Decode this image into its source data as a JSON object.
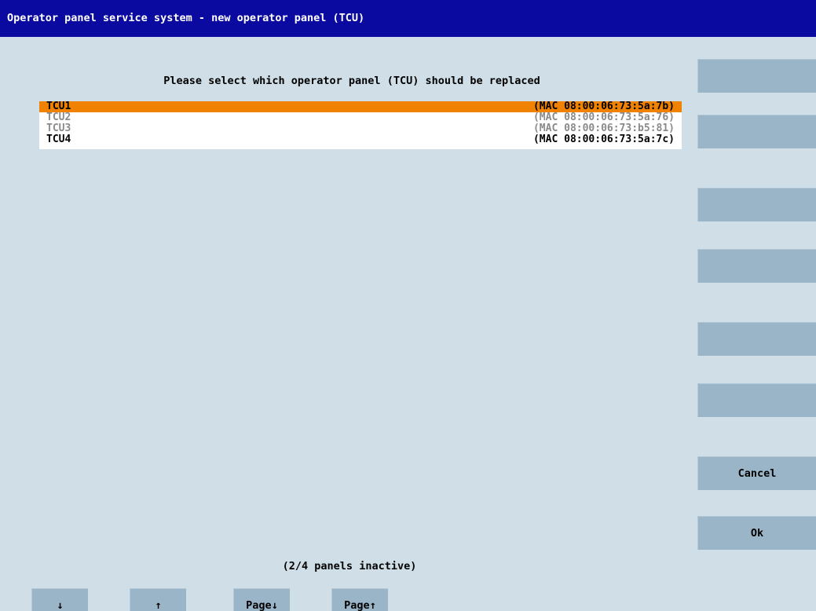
{
  "window": {
    "title": "Operator panel service system - new operator panel (TCU)"
  },
  "prompt": "Please select which operator panel (TCU) should be replaced",
  "panels": [
    {
      "name": "TCU1",
      "mac": "(MAC 08:00:06:73:5a:7b)",
      "state": "selected"
    },
    {
      "name": "TCU2",
      "mac": "(MAC 08:00:06:73:5a:76)",
      "state": "inactive"
    },
    {
      "name": "TCU3",
      "mac": "(MAC 08:00:06:73:b5:81)",
      "state": "inactive"
    },
    {
      "name": "TCU4",
      "mac": "(MAC 08:00:06:73:5a:7c)",
      "state": "active"
    }
  ],
  "colors": {
    "title_bar": "#0a0aa0",
    "background": "#d0dfe7",
    "selection": "#f08200",
    "softkey": "#9bb5c8",
    "inactive_text": "#8a8a8a"
  },
  "softkeys": {
    "cancel": "Cancel",
    "ok": "Ok"
  },
  "status": "(2/4 panels inactive)",
  "bottom_keys": {
    "down": "↓",
    "up": "↑",
    "page_down": "Page↓",
    "page_up": "Page↑"
  }
}
